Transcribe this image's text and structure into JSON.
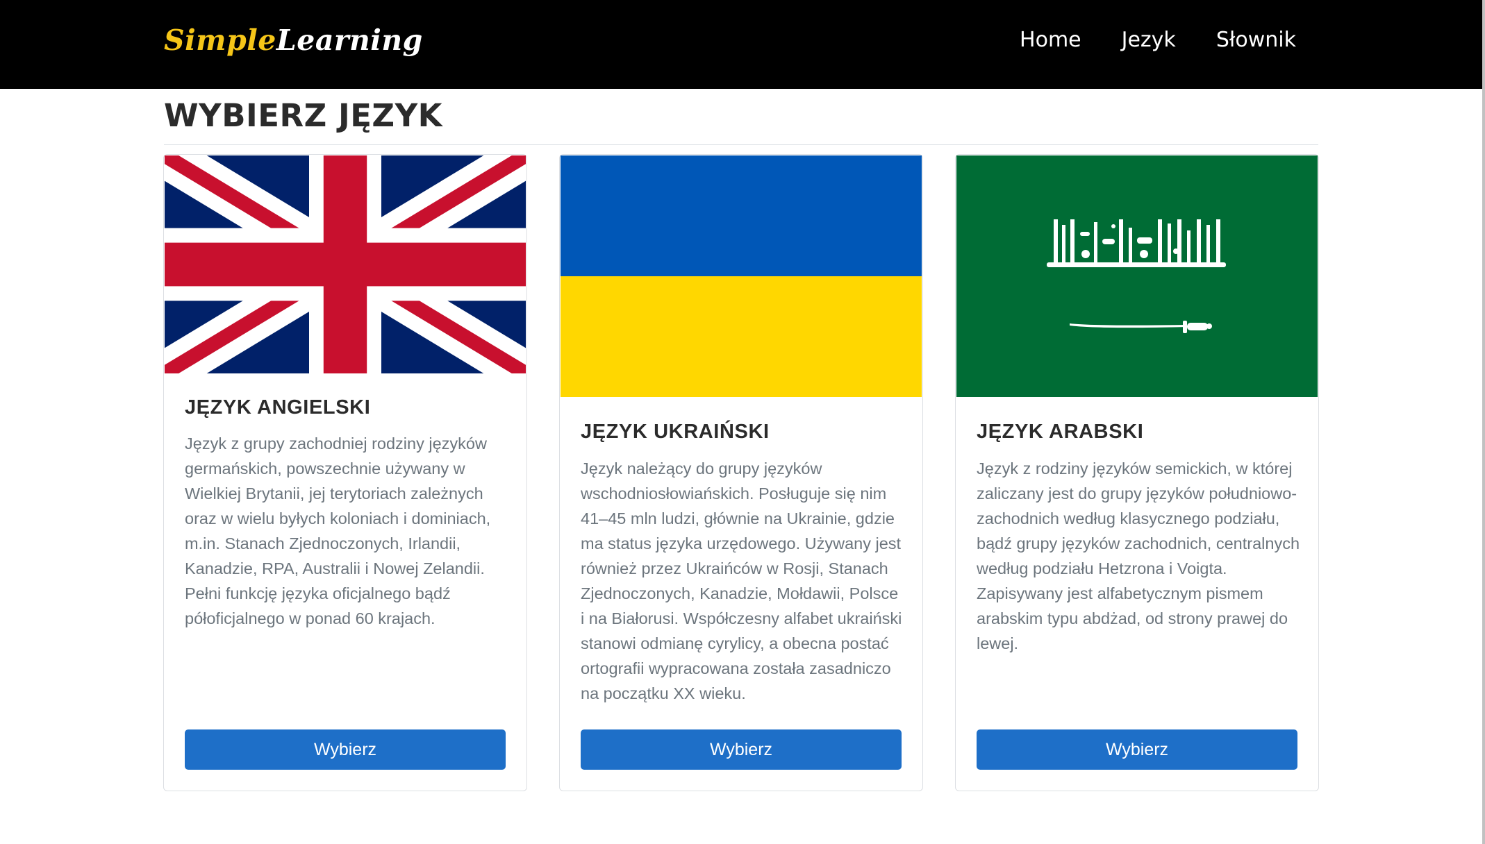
{
  "brand": {
    "part1": "Simple",
    "part2": "Learning"
  },
  "nav": {
    "items": [
      "Home",
      "Jezyk",
      "Słownik"
    ]
  },
  "page_title": "WYBIERZ JĘZYK",
  "cards": [
    {
      "title": "JĘZYK ANGIELSKI",
      "description": "Język z grupy zachodniej rodziny języków germańskich, powszechnie używany w Wielkiej Brytanii, jej terytoriach zależnych oraz w wielu byłych koloniach i dominiach, m.in. Stanach Zjednoczonych, Irlandii, Kanadzie, RPA, Australii i Nowej Zelandii. Pełni funkcję języka oficjalnego bądź półoficjalnego w ponad 60 krajach.",
      "button": "Wybierz",
      "flag_icon": "uk-flag-icon"
    },
    {
      "title": "JĘZYK UKRAIŃSKI",
      "description": "Język należący do grupy języków wschodniosłowiańskich. Posługuje się nim 41–45 mln ludzi, głównie na Ukrainie, gdzie ma status języka urzędowego. Używany jest również przez Ukraińców w Rosji, Stanach Zjednoczonych, Kanadzie, Mołdawii, Polsce i na Białorusi. Współczesny alfabet ukraiński stanowi odmianę cyrylicy, a obecna postać ortografii wypracowana została zasadniczo na początku XX wieku.",
      "button": "Wybierz",
      "flag_icon": "ukraine-flag-icon"
    },
    {
      "title": "JĘZYK ARABSKI",
      "description": "Język z rodziny języków semickich, w której zaliczany jest do grupy języków południowo-zachodnich według klasycznego podziału, bądź grupy języków zachodnich, centralnych według podziału Hetzrona i Voigta. Zapisywany jest alfabetycznym pismem arabskim typu abdżad, od strony prawej do lewej.",
      "button": "Wybierz",
      "flag_icon": "saudi-arabia-flag-icon"
    }
  ],
  "colors": {
    "navbar": "#000000",
    "brand_accent": "#f5c518",
    "button": "#1e6fc8",
    "uk_blue": "#012169",
    "uk_red": "#c8102e",
    "ua_blue": "#0057b7",
    "ua_yellow": "#ffd700",
    "sa_green": "#006c35"
  }
}
